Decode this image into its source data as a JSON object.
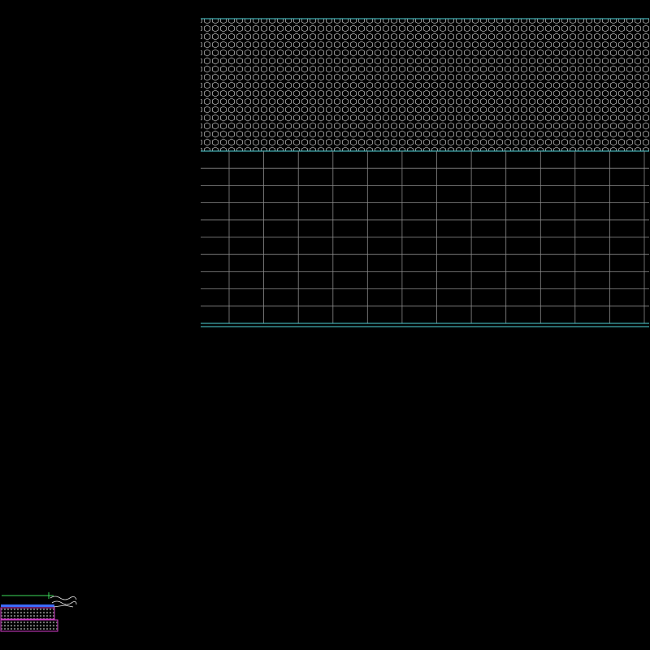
{
  "drawing": {
    "background_color": "#000000",
    "colors": {
      "cyan": "#4fd6dc",
      "grid_gray": "#8a8a8a",
      "pattern_gray": "#c8c8c8",
      "green": "#3ddc5a",
      "magenta": "#d23cc8",
      "blue": "#3c6cff",
      "white": "#e8e8e8"
    },
    "section_view": {
      "hatch_pattern": "hexagon-gravel",
      "grid_columns": 13,
      "grid_rows": 10
    },
    "detail_thumbnail": {
      "layers": [
        "green-leader-line",
        "blue-surface-layer",
        "magenta-gravel-layer-upper",
        "magenta-gravel-layer-lower",
        "white-break-line"
      ]
    }
  }
}
